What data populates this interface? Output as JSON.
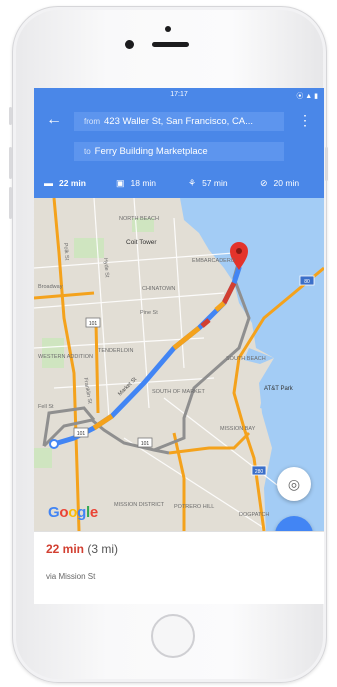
{
  "status_bar": {
    "time": "17:17",
    "icons": "⦿ ▲ ▮"
  },
  "header": {
    "back_icon": "back-arrow-icon",
    "menu_icon": "more-vert-icon",
    "from_prefix": "from",
    "from_value": "423 Waller St, San Francisco, CA...",
    "to_prefix": "to",
    "to_value": "Ferry Building Marketplace"
  },
  "travel_modes": [
    {
      "icon": "car-icon",
      "glyph": "▬",
      "label": "22 min",
      "active": true
    },
    {
      "icon": "transit-icon",
      "glyph": "▣",
      "label": "18 min",
      "active": false
    },
    {
      "icon": "walk-icon",
      "glyph": "⚘",
      "label": "57 min",
      "active": false
    },
    {
      "icon": "bike-icon",
      "glyph": "⊘",
      "label": "20 min",
      "active": false
    }
  ],
  "map": {
    "labels": [
      "NORTH BEACH",
      "Coit Tower",
      "EMBARCADERO",
      "CHINATOWN",
      "Broadway",
      "Pine St",
      "TENDERLOIN",
      "SOUTH OF MARKET",
      "Market St",
      "AT&T Park",
      "Franklin St",
      "Fell St",
      "SOUTH BEACH",
      "MISSION BAY",
      "MISSION DISTRICT",
      "POTRERO HILL",
      "DOGPATCH",
      "WESTERN ADDITION",
      "Hyde St",
      "Polk St"
    ],
    "shields": [
      "101",
      "101",
      "101",
      "280",
      "80"
    ],
    "google_logo": "Google"
  },
  "fab": {
    "locate_icon": "my-location-icon",
    "navigate_icon": "navigate-chevron-icon",
    "navigate_glyph": "»",
    "locate_glyph": "◎"
  },
  "summary": {
    "duration": "22 min",
    "distance": "(3 mi)",
    "via": "via Mission St"
  },
  "colors": {
    "header_blue": "#4a87e8",
    "route_blue": "#4285f4",
    "traffic_red": "#d23f31",
    "traffic_orange": "#f4a21c",
    "pin_red": "#e4332b",
    "water": "#a3ccf5"
  }
}
